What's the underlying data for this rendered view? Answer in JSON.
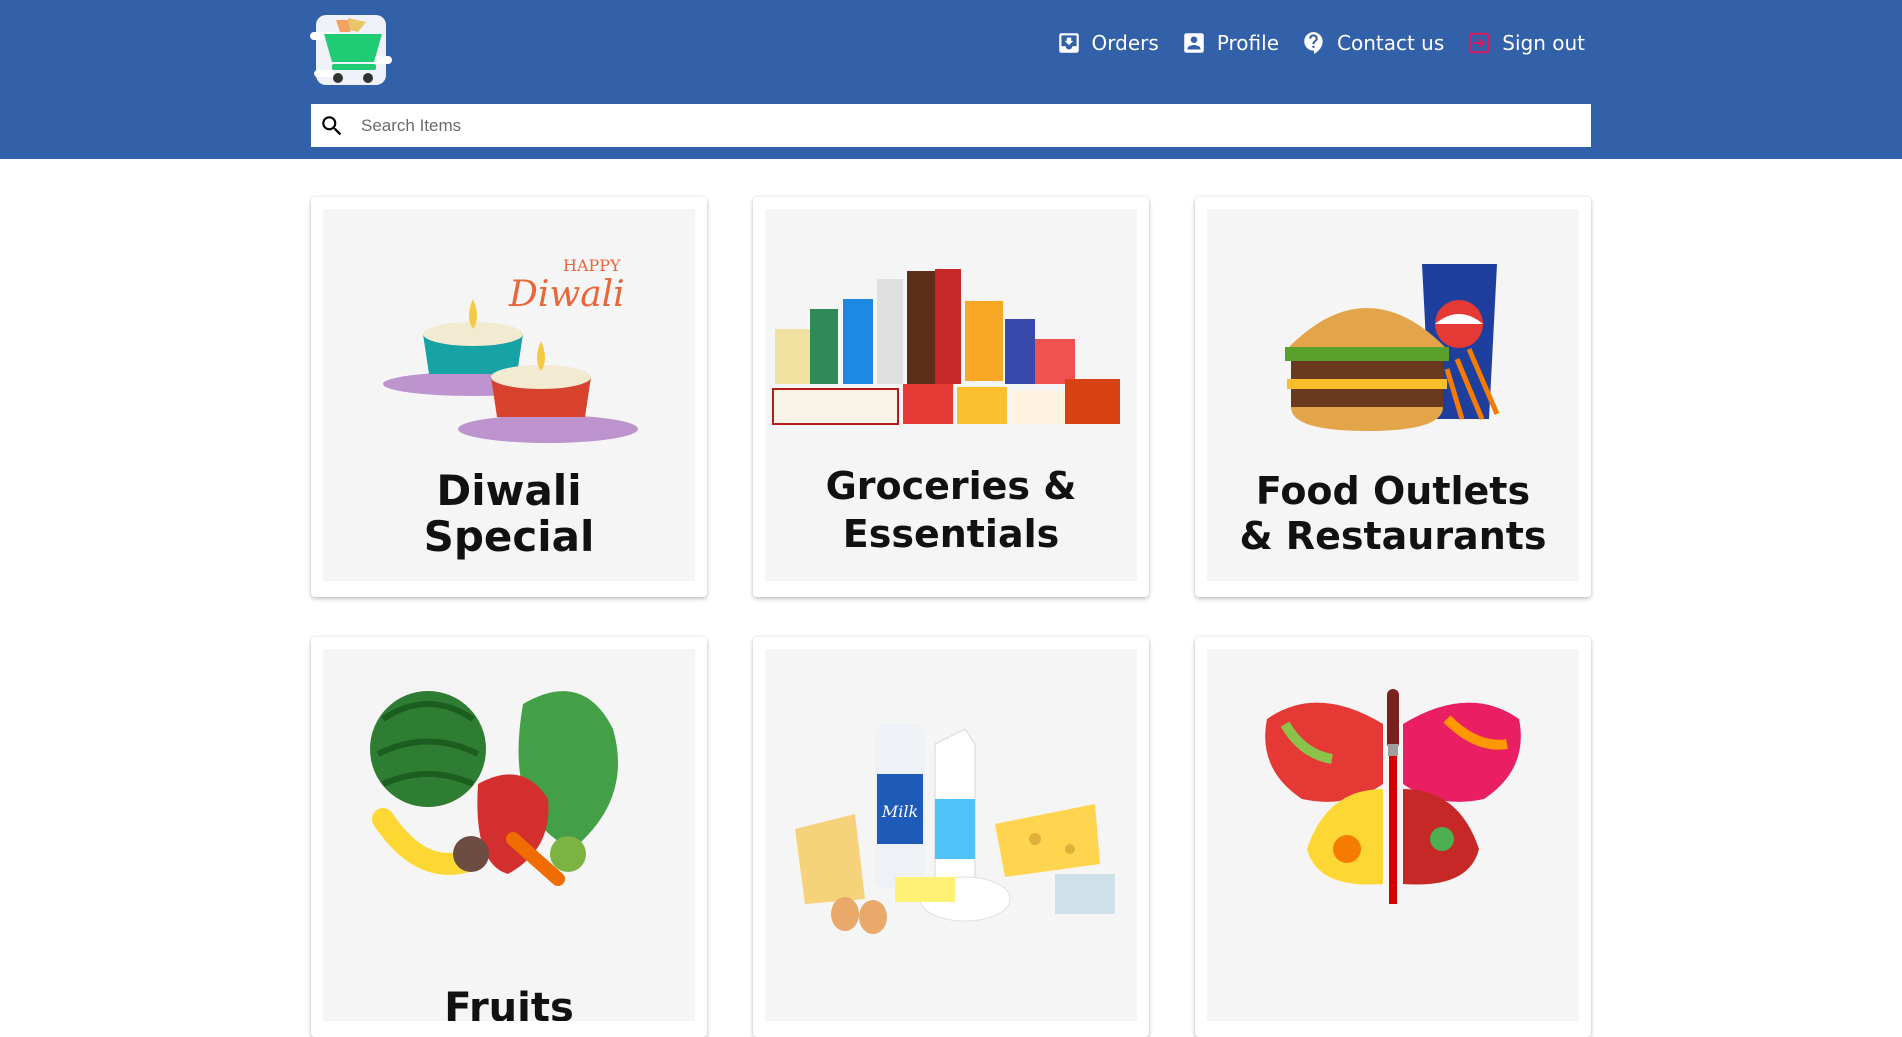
{
  "header": {
    "logo_icon": "shopping-cart-logo",
    "background_color": "#3260a9"
  },
  "nav": {
    "items": [
      {
        "label": "Orders",
        "icon": "inbox-icon"
      },
      {
        "label": "Profile",
        "icon": "account-box-icon"
      },
      {
        "label": "Contact us",
        "icon": "help-icon"
      },
      {
        "label": "Sign out",
        "icon": "exit-icon"
      }
    ]
  },
  "search": {
    "placeholder": "Search Items",
    "value": "",
    "icon": "search-icon"
  },
  "categories": [
    {
      "title_lines": [
        "Diwali",
        "Special"
      ],
      "image_text": "HAPPY Diwali",
      "image": "diwali-lamps"
    },
    {
      "title_lines": [
        "Groceries &",
        "Essentials"
      ],
      "image": "grocery-products"
    },
    {
      "title_lines": [
        "Food Outlets",
        "& Restaurants"
      ],
      "image": "burger-and-soda"
    },
    {
      "title_lines": [
        "Fruits"
      ],
      "image": "fruits-vegetables"
    },
    {
      "title_lines": [],
      "image": "milk-and-cheese",
      "image_text": "Milk"
    },
    {
      "title_lines": [],
      "image": "butterfly-paintbrush"
    }
  ]
}
